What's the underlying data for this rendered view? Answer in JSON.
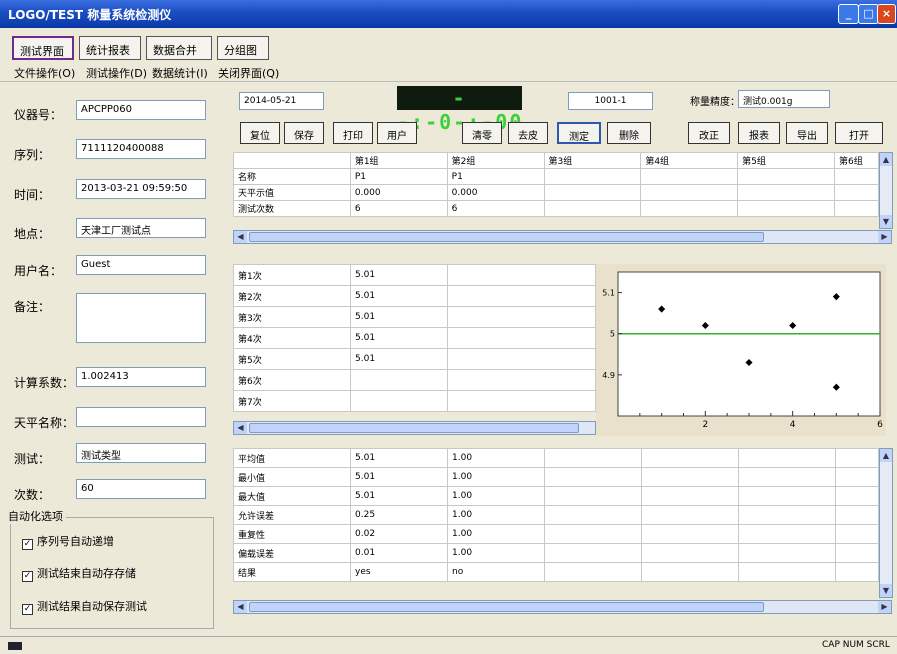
{
  "window": {
    "title": "LOGO/TEST 称量系统检测仪",
    "buttons": {
      "min": "_",
      "max": "□",
      "close": "×"
    }
  },
  "tabs": [
    {
      "label": "测试界面"
    },
    {
      "label": "统计报表"
    },
    {
      "label": "数据合并"
    },
    {
      "label": "分组图"
    }
  ],
  "menu": [
    {
      "label": "文件操作(O)"
    },
    {
      "label": "测试操作(D)"
    },
    {
      "label": "数据统计(I)"
    },
    {
      "label": "关闭界面(Q)"
    }
  ],
  "info": {
    "label_id": "仪器号：",
    "id": "APCPP060",
    "label_sn": "序列：",
    "sn": "7111120400088",
    "label_time": "时间：",
    "time": "2013-03-21 09:59:50",
    "label_place": "地点：",
    "place": "天津工厂测试点",
    "label_user": "用户名：",
    "user": "Guest",
    "label_note": "备注：",
    "note": "",
    "label_coef": "计算系数：",
    "coef": "1.002413",
    "label_scale": "天平名称：",
    "scale": "",
    "label_type": "测试：",
    "type": "测试类型",
    "label_count": "次数：",
    "count": "60"
  },
  "auto": {
    "title": "自动化选项",
    "options": [
      {
        "label": "序列号自动递增",
        "checked": true
      },
      {
        "label": "测试结束自动存存储",
        "checked": true
      },
      {
        "label": "测试结果自动保存测试",
        "checked": true
      }
    ]
  },
  "top": {
    "date": "2014-05-21",
    "lcd": "--:-0-:-00",
    "code": "1001-1",
    "balance_label": "称量精度：",
    "balance_value": "测试0.001g"
  },
  "buttons_left": [
    {
      "label": "复位"
    },
    {
      "label": "保存"
    },
    {
      "label": "打印"
    },
    {
      "label": "用户"
    }
  ],
  "buttons_mid": [
    {
      "label": "清零"
    },
    {
      "label": "去皮"
    },
    {
      "label": "测定",
      "selected": true
    },
    {
      "label": "删除"
    }
  ],
  "buttons_right": [
    {
      "label": "改正"
    },
    {
      "label": "报表"
    },
    {
      "label": "导出"
    },
    {
      "label": "打开"
    }
  ],
  "table1": {
    "headers": [
      "",
      "第1组",
      "第2组",
      "第3组",
      "第4组",
      "第5组",
      "第6组"
    ],
    "rows": [
      [
        "名称",
        "P1",
        "P1",
        "",
        "",
        "",
        ""
      ],
      [
        "天平示值",
        "0.000",
        "0.000",
        "",
        "",
        "",
        ""
      ],
      [
        "测试次数",
        "6",
        "6",
        "",
        "",
        "",
        ""
      ]
    ]
  },
  "table2": {
    "rows": [
      [
        "第1次",
        "5.01",
        ""
      ],
      [
        "第2次",
        "5.01",
        ""
      ],
      [
        "第3次",
        "5.01",
        ""
      ],
      [
        "第4次",
        "5.01",
        ""
      ],
      [
        "第5次",
        "5.01",
        ""
      ],
      [
        "第6次",
        "",
        ""
      ],
      [
        "第7次",
        "",
        ""
      ]
    ]
  },
  "table3": {
    "rows": [
      [
        "平均值",
        "5.01",
        "1.00",
        "",
        "",
        "",
        ""
      ],
      [
        "最小值",
        "5.01",
        "1.00",
        "",
        "",
        "",
        ""
      ],
      [
        "最大值",
        "5.01",
        "1.00",
        "",
        "",
        "",
        ""
      ],
      [
        "允许误差",
        "0.25",
        "1.00",
        "",
        "",
        "",
        ""
      ],
      [
        "重复性",
        "0.02",
        "1.00",
        "",
        "",
        "",
        ""
      ],
      [
        "偏载误差",
        "0.01",
        "1.00",
        "",
        "",
        "",
        ""
      ],
      [
        "结果",
        "yes",
        "no",
        "",
        "",
        "",
        ""
      ]
    ]
  },
  "status": {
    "right": "CAP NUM SCRL"
  },
  "chart_data": {
    "type": "scatter",
    "x": [
      1,
      2,
      3,
      4,
      5
    ],
    "y": [
      5.06,
      5.02,
      4.93,
      5.02,
      5.09,
      4.87
    ],
    "points": [
      [
        1,
        5.06
      ],
      [
        2,
        5.02
      ],
      [
        3,
        4.93
      ],
      [
        4,
        5.02
      ],
      [
        5,
        5.09
      ],
      [
        5,
        4.87
      ]
    ],
    "reference_line": 5.0,
    "xlim": [
      0,
      6
    ],
    "ylim": [
      4.8,
      5.15
    ],
    "xticks": [
      "2",
      "4",
      "6"
    ],
    "yticks": [
      "5.1",
      "5",
      "4.9"
    ],
    "colors": {
      "line": "#2fb32f",
      "points": "#000000"
    }
  }
}
